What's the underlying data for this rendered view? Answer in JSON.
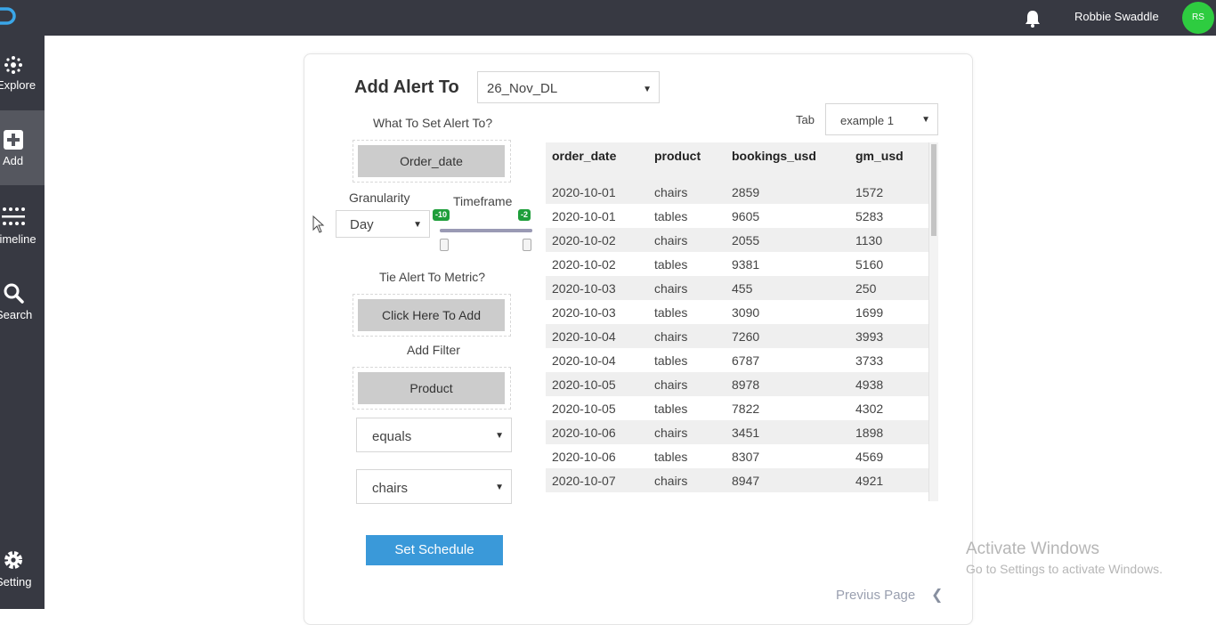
{
  "header": {
    "user_name": "Robbie Swaddle",
    "avatar_initials": "RS",
    "avatar_color": "#2ecc40",
    "notification_icon": "bell-icon"
  },
  "sidebar": {
    "items": [
      {
        "label": "Explore",
        "icon": "explore-icon"
      },
      {
        "label": "Add",
        "icon": "add-icon",
        "active": true
      },
      {
        "label": "Timeline",
        "icon": "timeline-icon"
      },
      {
        "label": "Search",
        "icon": "search-icon"
      },
      {
        "label": "Setting",
        "icon": "gear-icon"
      }
    ]
  },
  "form": {
    "title": "Add Alert To",
    "dataset_select": "26_Nov_DL",
    "what_label": "What To Set Alert To?",
    "what_value": "Order_date",
    "granularity_label": "Granularity",
    "granularity_value": "Day",
    "timeframe_label": "Timeframe",
    "timeframe_min": "-10",
    "timeframe_max": "-2",
    "metric_label": "Tie Alert To Metric?",
    "metric_button": "Click Here To Add",
    "filter_label": "Add Filter",
    "filter_value": "Product",
    "operator_select": "equals",
    "filter_value_select": "chairs",
    "submit_button": "Set Schedule"
  },
  "table_panel": {
    "tab_label": "Tab",
    "tab_select": "example 1",
    "columns": [
      "order_date",
      "product",
      "bookings_usd",
      "gm_usd"
    ],
    "rows": [
      [
        "2020-10-01",
        "chairs",
        "2859",
        "1572"
      ],
      [
        "2020-10-01",
        "tables",
        "9605",
        "5283"
      ],
      [
        "2020-10-02",
        "chairs",
        "2055",
        "1130"
      ],
      [
        "2020-10-02",
        "tables",
        "9381",
        "5160"
      ],
      [
        "2020-10-03",
        "chairs",
        "455",
        "250"
      ],
      [
        "2020-10-03",
        "tables",
        "3090",
        "1699"
      ],
      [
        "2020-10-04",
        "chairs",
        "7260",
        "3993"
      ],
      [
        "2020-10-04",
        "tables",
        "6787",
        "3733"
      ],
      [
        "2020-10-05",
        "chairs",
        "8978",
        "4938"
      ],
      [
        "2020-10-05",
        "tables",
        "7822",
        "4302"
      ],
      [
        "2020-10-06",
        "chairs",
        "3451",
        "1898"
      ],
      [
        "2020-10-06",
        "tables",
        "8307",
        "4569"
      ],
      [
        "2020-10-07",
        "chairs",
        "8947",
        "4921"
      ]
    ]
  },
  "pagination": {
    "prev_label": "Previus Page"
  },
  "watermark": {
    "line1": "Activate Windows",
    "line2": "Go to Settings to activate Windows."
  }
}
